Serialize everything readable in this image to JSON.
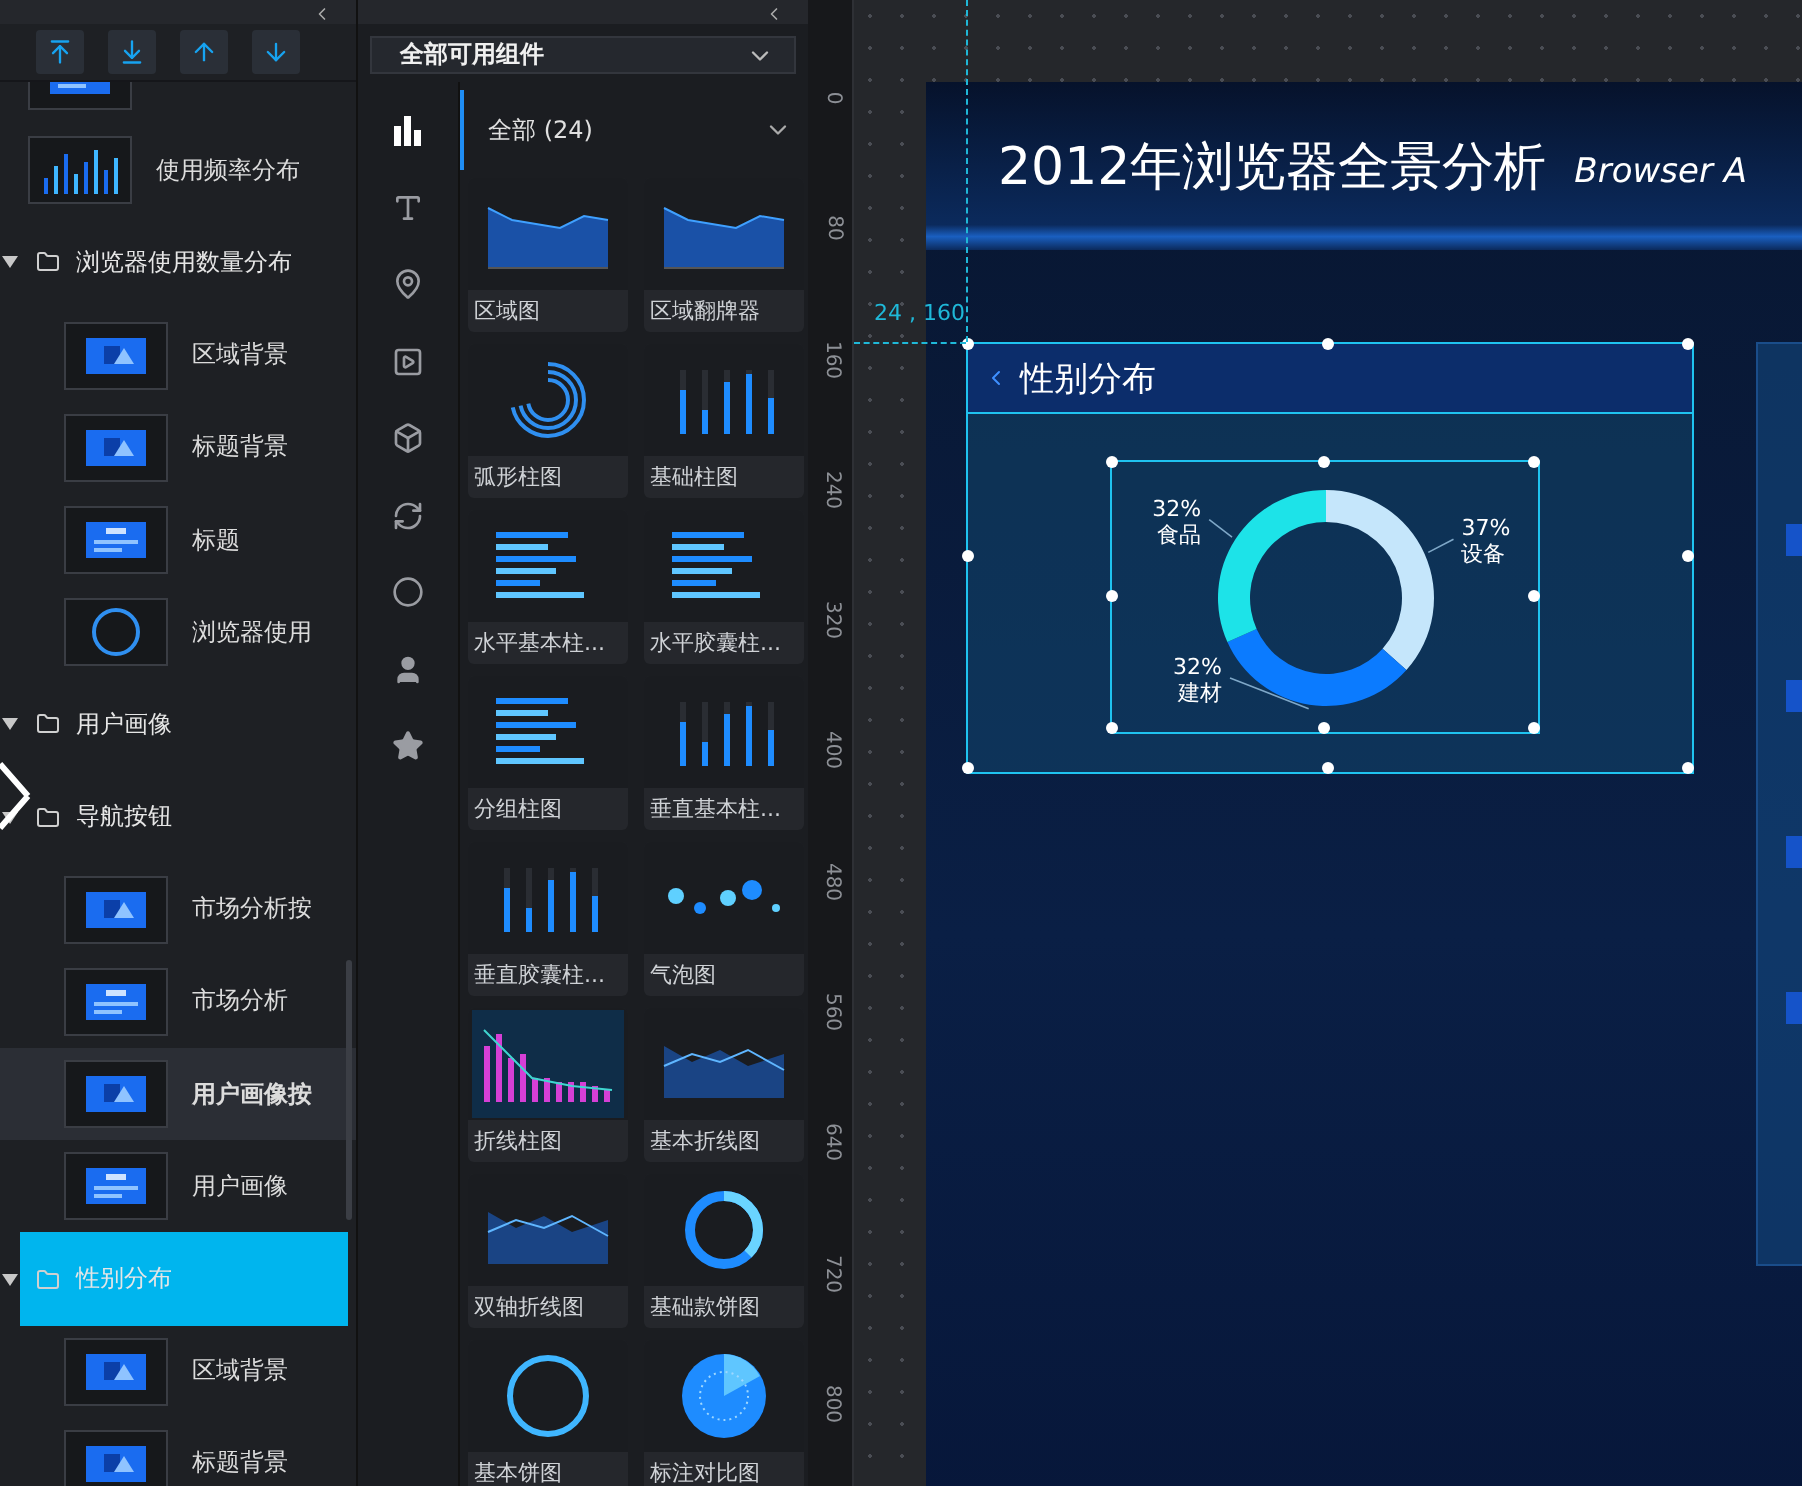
{
  "layers_panel": {
    "toolbar": [
      {
        "kind": "to-top"
      },
      {
        "kind": "to-bottom"
      },
      {
        "kind": "up"
      },
      {
        "kind": "down"
      }
    ],
    "layers": [
      {
        "kind": "continued",
        "children": [
          {
            "kind": "title",
            "selected": false
          },
          {
            "kind": "bars",
            "name": "使用频率分布",
            "selected": false
          },
          {
            "kind": "folder",
            "name": "浏览器使用数量分布",
            "expanded": true,
            "selected": false,
            "children": [
              {
                "kind": "image",
                "name": "区域背景",
                "selected": false
              },
              {
                "kind": "image",
                "name": "标题背景",
                "selected": false
              },
              {
                "kind": "title",
                "name": "标题",
                "selected": false
              },
              {
                "kind": "ring",
                "name": "浏览器使用",
                "selected": false
              }
            ]
          }
        ]
      },
      {
        "kind": "folder",
        "name": "用户画像",
        "expanded": true,
        "selected": false,
        "children": [
          {
            "kind": "folder",
            "name": "导航按钮",
            "expanded": true,
            "selected": false,
            "children": [
              {
                "kind": "image",
                "name": "市场分析按",
                "selected": false
              },
              {
                "kind": "title",
                "name": "市场分析",
                "selected": false
              },
              {
                "kind": "image",
                "name": "用户画像按",
                "selected": true
              },
              {
                "kind": "title",
                "name": "用户画像",
                "selected": false
              }
            ]
          },
          {
            "kind": "folder",
            "name": "性别分布",
            "expanded": true,
            "selected": true,
            "children": [
              {
                "kind": "image",
                "name": "区域背景",
                "selected": false
              },
              {
                "kind": "image",
                "name": "标题背景",
                "selected": false
              }
            ]
          }
        ]
      }
    ]
  },
  "components_panel": {
    "filter": {
      "value": "全部可用组件"
    },
    "categories": [
      {
        "kind": "chart",
        "selected": true
      },
      {
        "kind": "text",
        "selected": false
      },
      {
        "kind": "map",
        "selected": false
      },
      {
        "kind": "media",
        "selected": false
      },
      {
        "kind": "cube",
        "selected": false
      },
      {
        "kind": "interaction",
        "selected": false
      },
      {
        "kind": "other",
        "selected": false
      },
      {
        "kind": "user",
        "selected": false
      },
      {
        "kind": "favorite",
        "selected": false
      }
    ],
    "group": {
      "label": "全部 (24)",
      "selected": true
    },
    "cards": [
      {
        "kind": "area",
        "label": "区域图"
      },
      {
        "kind": "area",
        "label": "区域翻牌器"
      },
      {
        "kind": "arc",
        "label": "弧形柱图"
      },
      {
        "kind": "vbar",
        "label": "基础柱图"
      },
      {
        "kind": "hbar",
        "label": "水平基本柱..."
      },
      {
        "kind": "hbar",
        "label": "水平胶囊柱..."
      },
      {
        "kind": "hbar",
        "label": "分组柱图"
      },
      {
        "kind": "vbar",
        "label": "垂直基本柱..."
      },
      {
        "kind": "vbar",
        "label": "垂直胶囊柱..."
      },
      {
        "kind": "bubble",
        "label": "气泡图"
      },
      {
        "kind": "combo",
        "label": "折线柱图"
      },
      {
        "kind": "line",
        "label": "基本折线图"
      },
      {
        "kind": "line",
        "label": "双轴折线图"
      },
      {
        "kind": "donut",
        "label": "基础款饼图"
      },
      {
        "kind": "ring",
        "label": "基本饼图"
      },
      {
        "kind": "radar",
        "label": "标注对比图"
      }
    ]
  },
  "ruler": {
    "marks": [
      "0",
      "80",
      "160",
      "240",
      "320",
      "400",
      "480",
      "560",
      "640",
      "720",
      "800"
    ]
  },
  "canvas": {
    "guide_label": "24 , 160",
    "dashboard": {
      "title": "2012年浏览器全景分析",
      "subtitle": "Browser A",
      "widget": {
        "title": "性别分布",
        "selected": true,
        "chart_data": {
          "type": "donut",
          "categories": [
            "设备",
            "建材",
            "食品"
          ],
          "values": [
            37,
            32,
            32
          ],
          "value_labels": [
            "37%",
            "32%",
            "32%"
          ],
          "colors": [
            "#c5e6fb",
            "#0b7bff",
            "#1de3e8"
          ]
        }
      }
    }
  }
}
